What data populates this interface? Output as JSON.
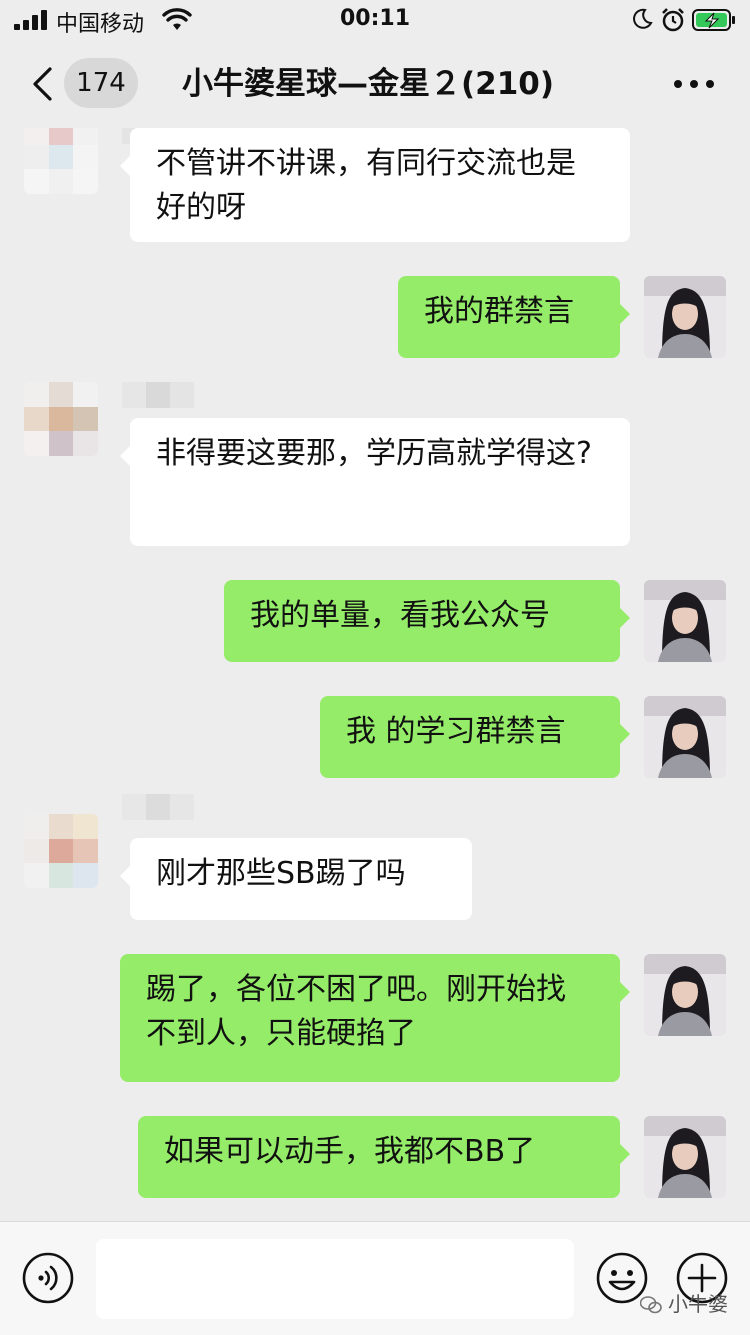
{
  "status_bar": {
    "carrier": "中国移动",
    "time": "00:11"
  },
  "nav": {
    "unread_badge": "174",
    "title": "小牛婆星球—金星２(210)"
  },
  "messages": [
    {
      "side": "left",
      "text": "不管讲不讲课，有同行交流也是好的呀"
    },
    {
      "side": "right",
      "text": "我的群禁言"
    },
    {
      "side": "left",
      "text": "非得要这要那，学历高就学得这?"
    },
    {
      "side": "right",
      "text": "我的单量，看我公众号"
    },
    {
      "side": "right",
      "text": "我 的学习群禁言"
    },
    {
      "side": "left",
      "text": "刚才那些SB踢了吗"
    },
    {
      "side": "right",
      "text": "踢了，各位不困了吧。刚开始找不到人，只能硬掐了"
    },
    {
      "side": "right",
      "text": "如果可以动手，我都不BB了"
    }
  ],
  "input_bar": {
    "value": "",
    "voice_icon": "voice-icon",
    "emoji_icon": "emoji-icon",
    "plus_icon": "plus-icon"
  },
  "watermark": "小牛婆",
  "colors": {
    "background": "#ededed",
    "my_bubble": "#95ec69",
    "their_bubble": "#ffffff",
    "battery_charging": "#34c759"
  }
}
